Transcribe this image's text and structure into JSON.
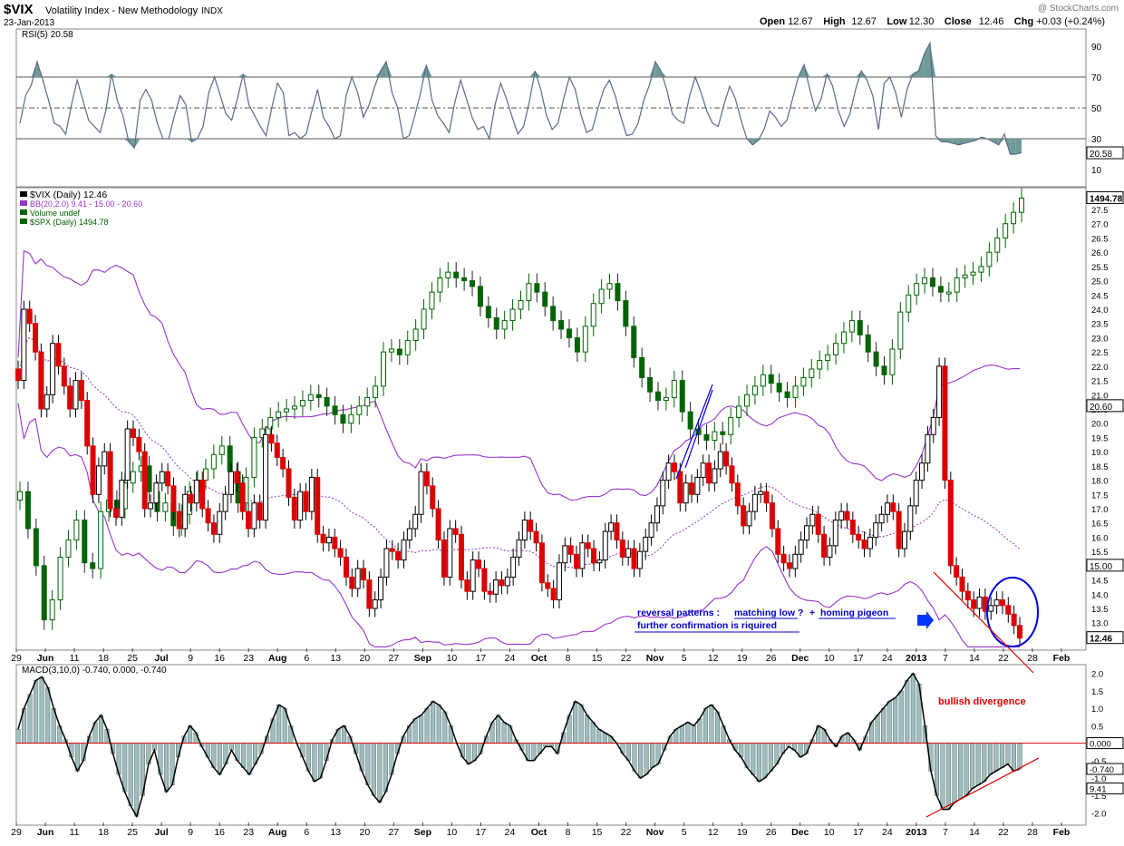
{
  "header": {
    "symbol": "$VIX",
    "name": "Volatility Index - New Methodology",
    "exchange": "INDX",
    "date": "23-Jan-2013",
    "watermark": "@ StockCharts.com",
    "ohlc": [
      {
        "label": "Open",
        "value": "12.67"
      },
      {
        "label": "High",
        "value": "12.67"
      },
      {
        "label": "Low",
        "value": "12.30"
      },
      {
        "label": "Close",
        "value": "12.46"
      },
      {
        "label": "Chg",
        "value": "+0.03 (+0.24%)"
      }
    ]
  },
  "chart_data": [
    {
      "type": "line",
      "panel": "rsi",
      "label": "RSI(5) 20.58",
      "ylim": [
        0,
        100
      ],
      "yticks": [
        10,
        30,
        50,
        70,
        90
      ],
      "levels": [
        30,
        50,
        70
      ],
      "last_label": "20.58",
      "values": [
        40,
        58,
        65,
        80,
        68,
        55,
        40,
        38,
        33,
        52,
        68,
        55,
        42,
        38,
        34,
        48,
        72,
        55,
        45,
        28,
        24,
        55,
        62,
        55,
        40,
        30,
        30,
        45,
        58,
        52,
        28,
        30,
        38,
        60,
        70,
        58,
        46,
        42,
        56,
        72,
        52,
        45,
        38,
        32,
        50,
        66,
        60,
        32,
        34,
        30,
        33,
        48,
        62,
        44,
        38,
        30,
        32,
        58,
        70,
        60,
        44,
        52,
        64,
        74,
        80,
        60,
        50,
        30,
        32,
        45,
        60,
        78,
        55,
        45,
        40,
        34,
        54,
        68,
        56,
        44,
        36,
        38,
        30,
        52,
        66,
        56,
        44,
        33,
        38,
        54,
        74,
        62,
        45,
        36,
        40,
        56,
        70,
        62,
        46,
        34,
        36,
        50,
        62,
        68,
        58,
        44,
        32,
        33,
        40,
        55,
        65,
        80,
        74,
        62,
        46,
        42,
        40,
        58,
        70,
        60,
        48,
        40,
        38,
        52,
        64,
        56,
        42,
        30,
        26,
        29,
        36,
        48,
        44,
        38,
        42,
        56,
        70,
        78,
        62,
        48,
        56,
        72,
        64,
        48,
        38,
        46,
        62,
        74,
        68,
        58,
        36,
        66,
        70,
        60,
        44,
        62,
        72,
        74,
        85,
        92,
        32,
        28,
        28,
        27,
        26,
        27,
        28,
        29,
        31,
        30,
        28,
        26,
        33,
        20,
        20,
        21
      ],
      "dates_note": "29 May 2012 – 23 Jan 2013 daily"
    },
    {
      "type": "candlestick",
      "panel": "price",
      "title": "$VIX (Daily) 12.46",
      "legend": [
        "$VIX (Daily) 12.46",
        "BB(20,2.0) 9.41 - 15.00 - 20.60",
        "Volume undef",
        "$SPX (Daily) 1494.78"
      ],
      "ylim": [
        12.1,
        28.2
      ],
      "yticks": [
        13.0,
        13.5,
        14.0,
        14.5,
        15.0,
        15.5,
        16.0,
        16.5,
        17.0,
        17.5,
        18.0,
        18.5,
        19.0,
        19.5,
        20.0,
        20.5,
        21.0,
        21.5,
        22.0,
        22.5,
        23.0,
        23.5,
        24.0,
        24.5,
        25.0,
        25.5,
        26.0,
        26.5,
        27.0,
        27.5
      ],
      "right_labels": [
        {
          "text": "1494.78",
          "value": 27.9
        },
        {
          "text": "20.60",
          "value": 20.6
        },
        {
          "text": "15.00",
          "value": 15.0
        },
        {
          "text": "12.46",
          "value": 12.46
        }
      ],
      "x_axis": [
        "29",
        "Jun",
        "11",
        "18",
        "25",
        "Jul",
        "9",
        "16",
        "23",
        "Aug",
        "6",
        "13",
        "20",
        "27",
        "Sep",
        "10",
        "17",
        "24",
        "Oct",
        "8",
        "15",
        "22",
        "Nov",
        "5",
        "12",
        "19",
        "26",
        "Dec",
        "10",
        "17",
        "24",
        "2013",
        "7",
        "14",
        "22",
        "28",
        "Feb"
      ],
      "vix_close": [
        21.5,
        24.0,
        23.5,
        22.5,
        20.5,
        21.0,
        22.8,
        22.0,
        21.3,
        20.5,
        21.5,
        20.8,
        19.2,
        17.5,
        18.5,
        19.0,
        17.0,
        16.7,
        18.0,
        19.8,
        19.5,
        19.0,
        17.0,
        17.2,
        17.9,
        18.3,
        17.8,
        16.9,
        16.3,
        17.5,
        17.2,
        18.0,
        17.0,
        16.5,
        16.1,
        16.9,
        17.5,
        18.3,
        17.9,
        16.9,
        16.3,
        17.2,
        16.6,
        19.6,
        19.3,
        18.8,
        18.4,
        17.4,
        16.6,
        17.6,
        16.9,
        18.1,
        16.1,
        15.8,
        16.0,
        15.6,
        15.3,
        14.6,
        14.2,
        14.9,
        14.5,
        13.5,
        13.8,
        14.6,
        15.6,
        15.5,
        15.2,
        15.9,
        16.3,
        16.8,
        18.3,
        17.8,
        17.0,
        15.9,
        14.6,
        16.3,
        16.1,
        14.5,
        14.1,
        15.2,
        14.9,
        14.1,
        14.0,
        14.5,
        14.3,
        14.6,
        15.3,
        15.9,
        16.6,
        16.2,
        15.8,
        14.4,
        14.2,
        13.8,
        15.1,
        15.7,
        15.4,
        14.9,
        15.8,
        15.6,
        15.1,
        15.2,
        16.2,
        16.5,
        15.9,
        15.3,
        15.6,
        14.9,
        15.5,
        16.0,
        16.5,
        17.1,
        18.0,
        18.6,
        18.3,
        17.2,
        17.9,
        17.5,
        18.1,
        18.6,
        17.9,
        18.4,
        19.0,
        18.5,
        17.9,
        17.1,
        16.4,
        16.9,
        17.5,
        17.6,
        17.2,
        16.3,
        15.4,
        15.1,
        14.9,
        15.4,
        15.9,
        16.4,
        16.8,
        16.1,
        15.3,
        15.7,
        16.6,
        16.9,
        16.6,
        16.1,
        15.9,
        15.6,
        16.0,
        16.5,
        16.8,
        17.2,
        16.9,
        15.6,
        16.2,
        17.1,
        18.0,
        18.6,
        19.6,
        20.2,
        22.0,
        18.0,
        15.0,
        14.6,
        14.1,
        13.8,
        13.5,
        13.9,
        13.4,
        13.6,
        13.8,
        13.6,
        13.3,
        12.9,
        12.46
      ],
      "spx_close": [
        17.6,
        16.3,
        15.0,
        13.1,
        13.8,
        15.3,
        15.9,
        16.6,
        15.1,
        14.9,
        16.9,
        17.3,
        17.0,
        17.9,
        18.3,
        18.5,
        17.6,
        16.9,
        17.2,
        16.4,
        16.8,
        17.6,
        18.0,
        18.4,
        18.9,
        19.2,
        18.3,
        17.2,
        18.1,
        19.5,
        19.8,
        20.2,
        20.4,
        20.5,
        20.6,
        20.8,
        21.0,
        20.9,
        20.6,
        20.3,
        20.0,
        20.3,
        20.6,
        20.9,
        21.3,
        22.5,
        22.6,
        22.4,
        22.9,
        23.3,
        24.0,
        24.6,
        25.1,
        25.3,
        25.1,
        25.0,
        24.8,
        24.1,
        23.7,
        23.3,
        23.6,
        24.0,
        24.3,
        24.9,
        24.6,
        24.1,
        23.6,
        23.3,
        23.0,
        22.5,
        23.4,
        24.2,
        24.7,
        24.9,
        24.3,
        23.4,
        22.3,
        21.6,
        21.1,
        20.8,
        20.9,
        21.5,
        20.4,
        19.8,
        19.6,
        19.4,
        19.7,
        19.6,
        20.2,
        20.6,
        21.0,
        21.3,
        21.7,
        21.4,
        21.1,
        20.9,
        21.3,
        21.6,
        21.9,
        22.2,
        22.4,
        22.8,
        23.2,
        23.6,
        23.1,
        22.5,
        22.0,
        21.7,
        22.6,
        23.9,
        24.5,
        24.9,
        25.1,
        24.8,
        24.6,
        24.6,
        25.1,
        25.2,
        25.3,
        25.5,
        26.0,
        26.5,
        27.0,
        27.4,
        27.9
      ]
    },
    {
      "type": "bar",
      "panel": "macd",
      "label": "MACD(3,10,0) -0.740, 0.000, -0.740",
      "ylim": [
        -2.3,
        2.2
      ],
      "yticks": [
        2.0,
        1.5,
        1.0,
        0.5,
        -0.5,
        -1.0,
        -1.5,
        -2.0
      ],
      "right_labels": [
        {
          "text": "0.000",
          "value": 0.0
        },
        {
          "text": "-0.740",
          "value": -0.74
        },
        {
          "text": "9.41",
          "value": -1.3
        }
      ],
      "values": [
        0.4,
        1.0,
        1.4,
        1.8,
        1.9,
        1.6,
        1.0,
        0.5,
        0.1,
        -0.4,
        -0.8,
        -0.5,
        0.2,
        0.6,
        0.8,
        0.4,
        -0.3,
        -0.9,
        -1.4,
        -1.8,
        -2.1,
        -1.5,
        -0.6,
        -0.2,
        -0.9,
        -1.4,
        -1.2,
        -0.4,
        0.2,
        0.5,
        0.3,
        -0.1,
        -0.4,
        -0.7,
        -0.9,
        -0.6,
        -0.2,
        -0.5,
        -0.7,
        -0.9,
        -0.6,
        -0.3,
        0.2,
        0.7,
        1.1,
        1.0,
        0.5,
        0.0,
        -0.4,
        -0.8,
        -1.1,
        -1.0,
        -0.5,
        0.1,
        0.4,
        0.5,
        0.2,
        -0.3,
        -0.8,
        -1.2,
        -1.5,
        -1.7,
        -1.4,
        -0.9,
        -0.3,
        0.2,
        0.5,
        0.7,
        0.8,
        1.0,
        1.2,
        1.1,
        0.9,
        0.5,
        0.0,
        -0.4,
        -0.6,
        -0.5,
        -0.3,
        0.2,
        0.6,
        0.8,
        0.6,
        0.5,
        0.1,
        -0.2,
        -0.5,
        -0.5,
        -0.3,
        -0.1,
        -0.1,
        -0.3,
        0.3,
        0.8,
        1.2,
        1.1,
        0.8,
        0.6,
        0.4,
        0.3,
        0.2,
        0.0,
        -0.3,
        -0.5,
        -0.8,
        -1.0,
        -0.9,
        -0.7,
        -0.6,
        -0.2,
        0.2,
        0.4,
        0.5,
        0.6,
        0.5,
        0.7,
        1.0,
        1.1,
        0.9,
        0.5,
        0.1,
        -0.2,
        -0.4,
        -0.7,
        -0.9,
        -1.1,
        -1.0,
        -0.8,
        -0.6,
        -0.3,
        -0.1,
        -0.2,
        -0.4,
        -0.3,
        0.1,
        0.5,
        0.4,
        0.1,
        -0.1,
        0.2,
        0.3,
        0.1,
        -0.2,
        0.2,
        0.6,
        0.8,
        1.0,
        1.2,
        1.3,
        1.5,
        1.8,
        2.0,
        1.7,
        0.5,
        -0.8,
        -1.5,
        -1.9,
        -1.9,
        -1.7,
        -1.6,
        -1.5,
        -1.3,
        -1.2,
        -1.1,
        -0.9,
        -0.8,
        -0.7,
        -0.6,
        -0.8,
        -0.74
      ],
      "x_axis": [
        "29",
        "Jun",
        "11",
        "18",
        "25",
        "Jul",
        "9",
        "16",
        "23",
        "Aug",
        "6",
        "13",
        "20",
        "27",
        "Sep",
        "10",
        "17",
        "24",
        "Oct",
        "8",
        "15",
        "22",
        "Nov",
        "5",
        "12",
        "19",
        "26",
        "Dec",
        "10",
        "17",
        "24",
        "2013",
        "7",
        "14",
        "22",
        "28",
        "Feb"
      ]
    }
  ],
  "annotations": {
    "reversal_line1": "reversal patterns :",
    "reversal_link1": "matching low ?",
    "reversal_plus": "+",
    "reversal_link2": "homing pigeon",
    "reversal_line2": "further confirmation is riquired",
    "divergence": "bullish divergence"
  },
  "colors": {
    "up": "#006400",
    "down": "#dd0000",
    "bb": "#9933cc",
    "rsi_line": "#5a6a8a",
    "rsi_fill": "#6f9a98",
    "macd_hist": "#9fbfbe",
    "annotation_blue": "#0000cc",
    "annotation_red": "#dd0000"
  }
}
